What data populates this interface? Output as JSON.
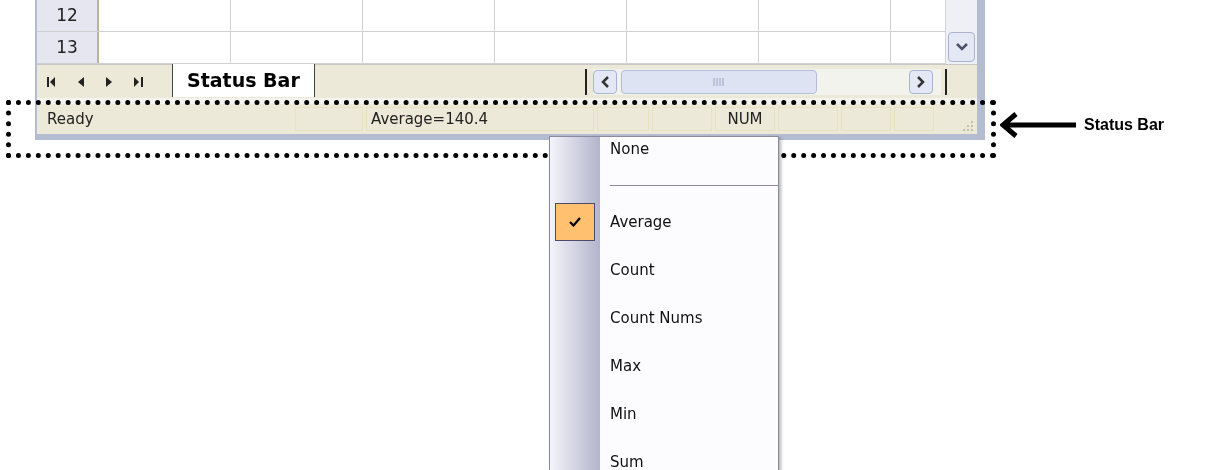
{
  "sheet": {
    "rows": [
      {
        "header": "12"
      },
      {
        "header": "13"
      }
    ]
  },
  "sheet_tabs": [
    {
      "label": "Status Bar",
      "selected": true
    }
  ],
  "status_bar": {
    "message": "Ready",
    "calc_readout": "Average=140.4",
    "num_lock": "NUM"
  },
  "context_menu": {
    "items": [
      {
        "kind": "item",
        "label": "None",
        "checked": false
      },
      {
        "kind": "separator"
      },
      {
        "kind": "item",
        "label": "Average",
        "checked": true
      },
      {
        "kind": "item",
        "label": "Count",
        "checked": false
      },
      {
        "kind": "item",
        "label": "Count Nums",
        "checked": false
      },
      {
        "kind": "item",
        "label": "Max",
        "checked": false
      },
      {
        "kind": "item",
        "label": "Min",
        "checked": false
      },
      {
        "kind": "item",
        "label": "Sum",
        "checked": false
      }
    ]
  },
  "annotation": {
    "label": "Status Bar"
  }
}
